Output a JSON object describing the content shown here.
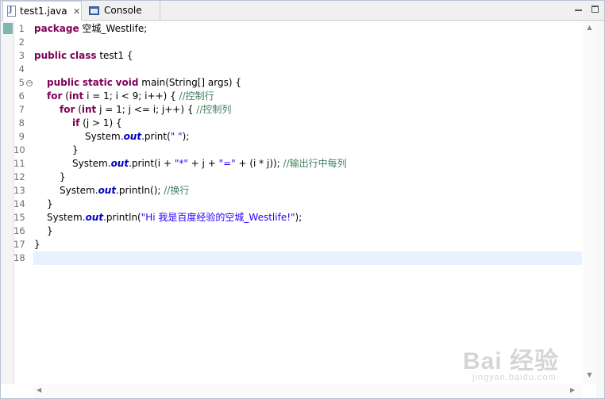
{
  "tabs": [
    {
      "label": "test1.java",
      "icon": "java-file-icon",
      "active": true,
      "close": "✕"
    },
    {
      "label": "Console",
      "icon": "console-icon",
      "active": false
    }
  ],
  "line_numbers": [
    "1",
    "2",
    "3",
    "4",
    "5",
    "6",
    "7",
    "8",
    "9",
    "10",
    "11",
    "12",
    "13",
    "14",
    "15",
    "16",
    "17",
    "18"
  ],
  "code": {
    "l1_kw": "package",
    "l1_rest": " 空城_Westlife;",
    "l3_kw1": "public",
    "l3_kw2": "class",
    "l3_rest": " test1 {",
    "l5_kw1": "public",
    "l5_kw2": "static",
    "l5_kw3": "void",
    "l5_rest": " main(String[] args) {",
    "l6_kw1": "for",
    "l6_a": " (",
    "l6_kw2": "int",
    "l6_b": " i = 1; i < 9; i++) { ",
    "l6_cm": "//控制行",
    "l7_kw1": "for",
    "l7_a": " (",
    "l7_kw2": "int",
    "l7_b": " j = 1; j <= i; j++) { ",
    "l7_cm": "//控制列",
    "l8_kw": "if",
    "l8_rest": " (j > 1) {",
    "l9_a": "System.",
    "l9_fld": "out",
    "l9_b": ".print(",
    "l9_str": "\" \"",
    "l9_c": ");",
    "l10": "}",
    "l11_a": "System.",
    "l11_fld": "out",
    "l11_b": ".print(i + ",
    "l11_str1": "\"*\"",
    "l11_c": " + j + ",
    "l11_str2": "\"=\"",
    "l11_d": " + (i * j)); ",
    "l11_cm": "//输出行中每列",
    "l12": "}",
    "l13_a": "System.",
    "l13_fld": "out",
    "l13_b": ".println(); ",
    "l13_cm": "//换行",
    "l14": "}",
    "l15_a": "System.",
    "l15_fld": "out",
    "l15_b": ".println(",
    "l15_str": "\"Hi 我是百度经验的空城_Westlife!\"",
    "l15_c": ");",
    "l16": "}",
    "l17": "}"
  },
  "watermark": {
    "main": "Bai 经验",
    "sub": "jingyan.baidu.com"
  },
  "colors": {
    "keyword": "#7f0055",
    "comment": "#3f7f5f",
    "string": "#2a00ff",
    "field": "#0000c0",
    "current_line": "#e8f2fe"
  }
}
